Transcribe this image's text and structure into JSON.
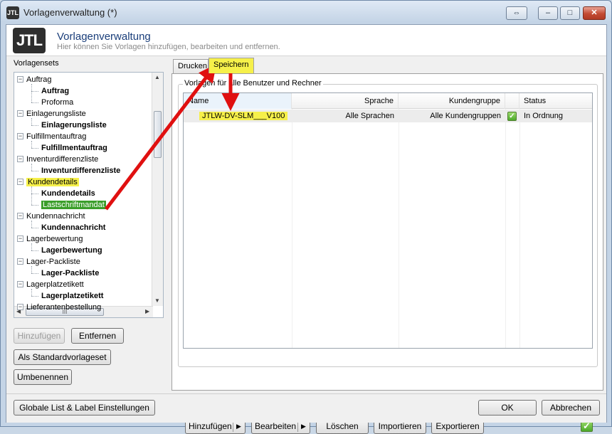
{
  "window": {
    "app_icon": "JTL",
    "title": "Vorlagenverwaltung (*)",
    "controls": {
      "restore": "⇔",
      "minimize": "–",
      "maximize": "□",
      "close": "✕"
    }
  },
  "header": {
    "logo": "JTL",
    "title": "Vorlagenverwaltung",
    "subtitle": "Hier können Sie Vorlagen hinzufügen, bearbeiten und entfernen."
  },
  "sidebar": {
    "label": "Vorlagensets",
    "tree": [
      {
        "label": "Auftrag",
        "children": [
          "Auftrag",
          "Proforma"
        ],
        "bold_child": 0
      },
      {
        "label": "Einlagerungsliste",
        "children": [
          "Einlagerungsliste"
        ]
      },
      {
        "label": "Fulfillmentauftrag",
        "children": [
          "Fulfillmentauftrag"
        ]
      },
      {
        "label": "Inventurdifferenzliste",
        "children": [
          "Inventurdifferenzliste"
        ]
      },
      {
        "label": "Kundendetails",
        "children": [
          "Kundendetails",
          "Lastschriftmandat"
        ]
      },
      {
        "label": "Kundennachricht",
        "children": [
          "Kundennachricht"
        ]
      },
      {
        "label": "Lagerbewertung",
        "children": [
          "Lagerbewertung"
        ]
      },
      {
        "label": "Lager-Packliste",
        "children": [
          "Lager-Packliste"
        ]
      },
      {
        "label": "Lagerplatzetikett",
        "children": [
          "Lagerplatzetikett"
        ]
      },
      {
        "label": "Lieferantenbestellung",
        "children": []
      }
    ],
    "hscroll_grip": "III",
    "buttons": {
      "add": "Hinzufügen",
      "remove": "Entfernen",
      "default": "Als Standardvorlageset",
      "rename": "Umbenennen"
    }
  },
  "tabs": [
    {
      "label": "Drucken",
      "active": false
    },
    {
      "label": "Speichern",
      "active": true
    }
  ],
  "panel": {
    "group_label": "Vorlagen für alle Benutzer und Rechner",
    "columns": [
      "Name",
      "Sprache",
      "Kundengruppe",
      "",
      "Status"
    ],
    "rows": [
      {
        "name": "JTLW-DV-SLM___V100",
        "language": "Alle Sprachen",
        "group": "Alle Kundengruppen",
        "status": "In Ordnung"
      }
    ],
    "buttons": {
      "add": "Hinzufügen",
      "edit": "Bearbeiten",
      "delete": "Löschen",
      "import": "Importieren",
      "export": "Exportieren"
    }
  },
  "footer": {
    "settings": "Globale List & Label Einstellungen",
    "ok": "OK",
    "cancel": "Abbrechen"
  },
  "colors": {
    "highlight_yellow": "#f6f04a",
    "highlight_green": "#3a9e2a",
    "annotation_red": "#e01010"
  },
  "icons": {
    "status_ok": "green-check-icon",
    "tree_expander": "minus-box-icon",
    "dropdown": "triangle-right-icon"
  }
}
